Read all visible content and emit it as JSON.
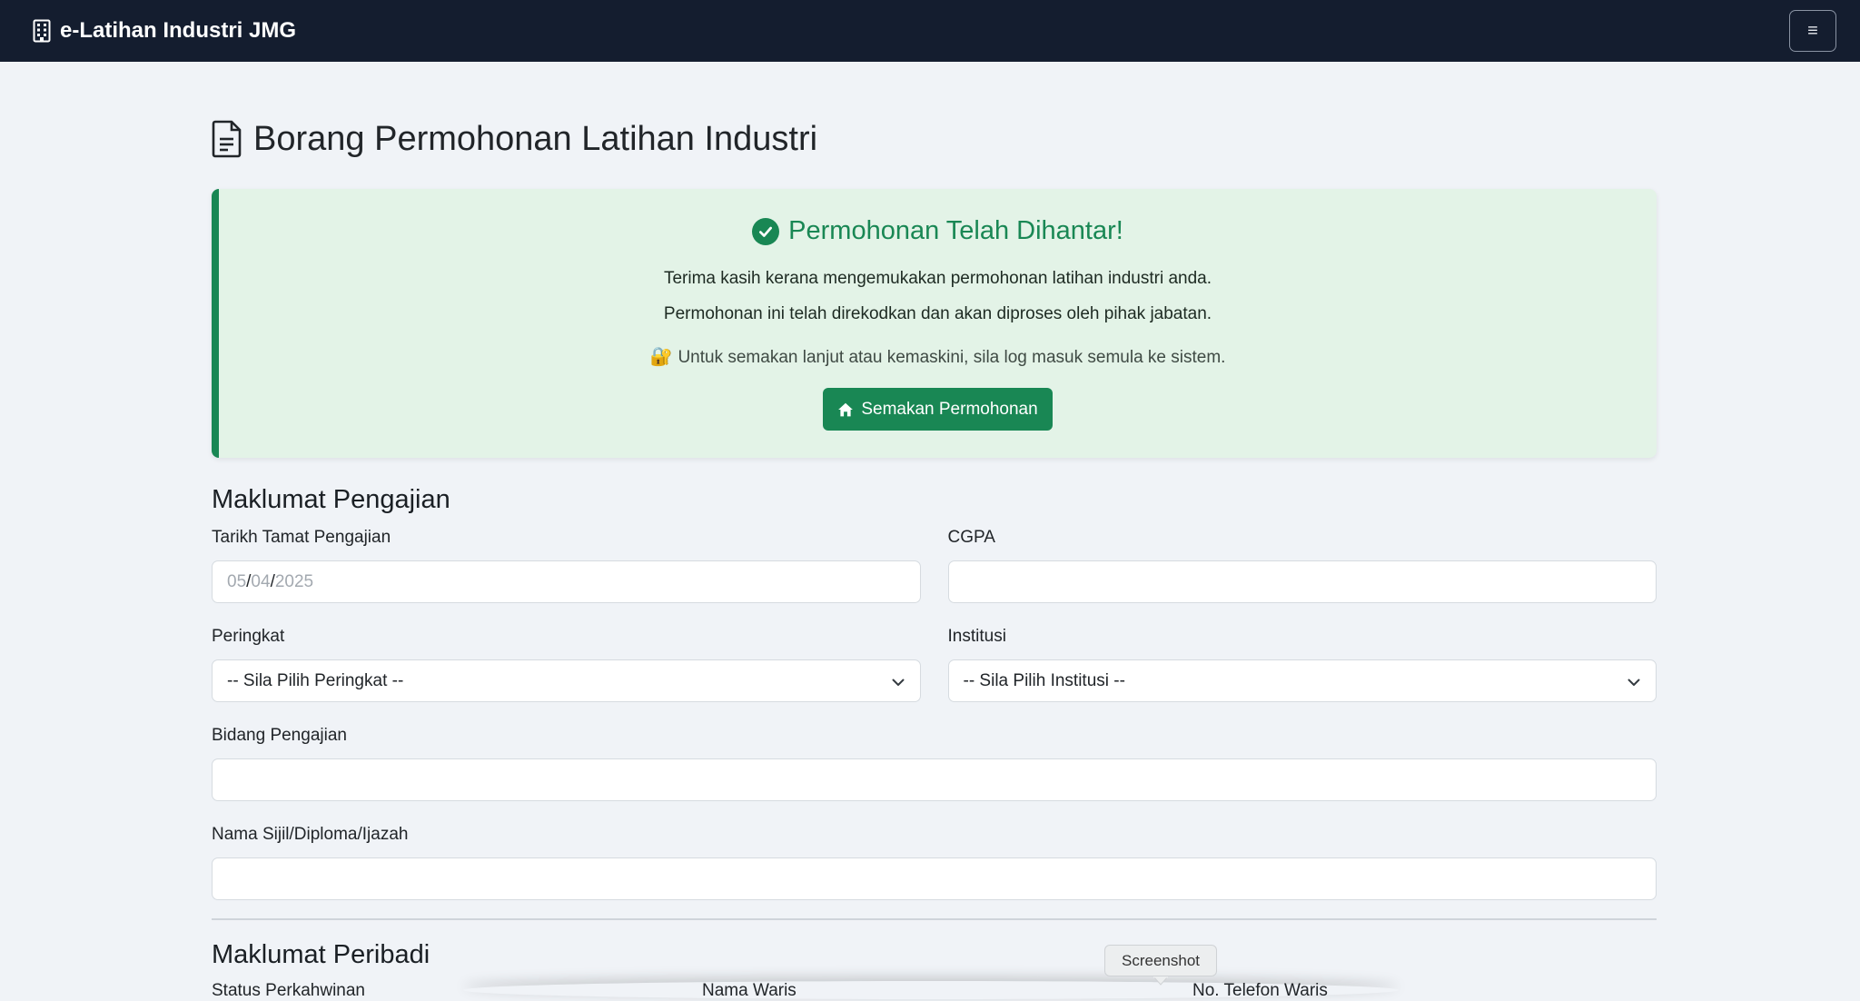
{
  "navbar": {
    "brand": "e-Latihan Industri JMG",
    "brand_icon": "building-icon",
    "menu_toggle": "≡"
  },
  "page": {
    "title": "Borang Permohonan Latihan Industri",
    "title_icon": "document-icon"
  },
  "alert": {
    "title": "Permohonan Telah Dihantar!",
    "line1": "Terima kasih kerana mengemukakan permohonan latihan industri anda.",
    "line2": "Permohonan ini telah direkodkan dan akan diproses oleh pihak jabatan.",
    "lock_emoji": "🔐",
    "line3": "Untuk semakan lanjut atau kemaskini, sila log masuk semula ke sistem.",
    "button_label": "Semakan Permohonan",
    "accent_color": "#198754"
  },
  "education": {
    "section_title": "Maklumat Pengajian",
    "graduation_date": {
      "label": "Tarikh Tamat Pengajian",
      "day": "05",
      "month": "04",
      "year": "2025"
    },
    "cgpa": {
      "label": "CGPA",
      "value": ""
    },
    "grade": {
      "label": "Peringkat",
      "selected": "-- Sila Pilih Peringkat --"
    },
    "institution": {
      "label": "Institusi",
      "selected": "-- Sila Pilih Institusi --"
    },
    "field_of_study": {
      "label": "Bidang Pengajian",
      "value": ""
    },
    "certificate_name": {
      "label": "Nama Sijil/Diploma/Ijazah",
      "value": ""
    }
  },
  "personal": {
    "section_title": "Maklumat Peribadi",
    "marital_status_label": "Status Perkahwinan",
    "heir_name_label": "Nama Waris",
    "heir_phone_label": "No. Telefon Waris"
  },
  "tooltip": {
    "text": "Screenshot"
  }
}
